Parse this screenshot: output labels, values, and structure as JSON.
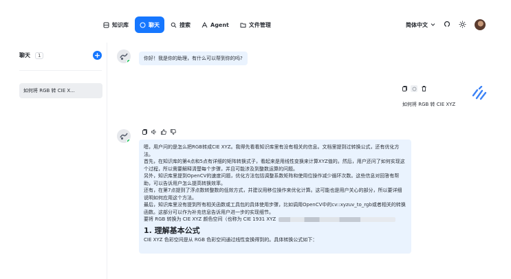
{
  "nav": {
    "tabs": [
      {
        "label": "知识库",
        "icon": "database-icon",
        "active": false
      },
      {
        "label": "聊天",
        "icon": "chat-icon",
        "active": true
      },
      {
        "label": "搜索",
        "icon": "search-icon",
        "active": false
      },
      {
        "label": "Agent",
        "icon": "agent-icon",
        "active": false
      },
      {
        "label": "文件管理",
        "icon": "folder-icon",
        "active": false
      }
    ],
    "language": "简体中文",
    "accent": "#1677ff"
  },
  "sidebar": {
    "title": "聊天",
    "count": "1",
    "conversations": [
      {
        "label": "如何将 RGB 转 CIE X..."
      }
    ]
  },
  "chat": {
    "greeting": "你好！我是你的助理，有什么可以帮到你的吗?",
    "user_message": "如何将 RGB 转 CIE XYZ",
    "answer": {
      "paragraphs": [
        "嗯，用户问的是怎么把RGB转成CIE XYZ。我得先看看知识库里有没有相关的信息。文档里提到过转换公式，还有优化方法。",
        "首先，在知识库的第4点和5点有详细的矩阵转换式子，看起来是用线性变换来计算XYZ值的。然后，用户还问了如何实现这个过程，所以需要解释清楚每个步骤，并且可能涉及到整数运算的问题。",
        "另外，知识库里提到OpenCV的速度问题，优化方法包括调整系数矩阵和使用位操作减少循环次数。这些信息对回答有帮助，可以告诉用户怎么提高转换效率。",
        "还有，在第7点提到了浮点数转整数的低效方式，并建议用移位操作来优化计算。这可能也是用户关心的部分，所以要详细说明如何应用这个方法。",
        "最后，知识库里没有提到所有相关函数或工具包的具体使用步骤，比如调用OpenCV中的cv::xyzuv_to_rgb或者相关的转换函数。这部分可以作为补充信息告诉用户进一步的实现细节。"
      ],
      "intro_line": "要将 RGB 转换为 CIE XYZ 颜色空间（也称为 CIE 1931 XYZ",
      "heading": "1. 理解基本公式",
      "formula_line": "CIE XYZ 色彩空间是从 RGB 色彩空间通过线性变换得到的。具体转换公式如下："
    }
  }
}
